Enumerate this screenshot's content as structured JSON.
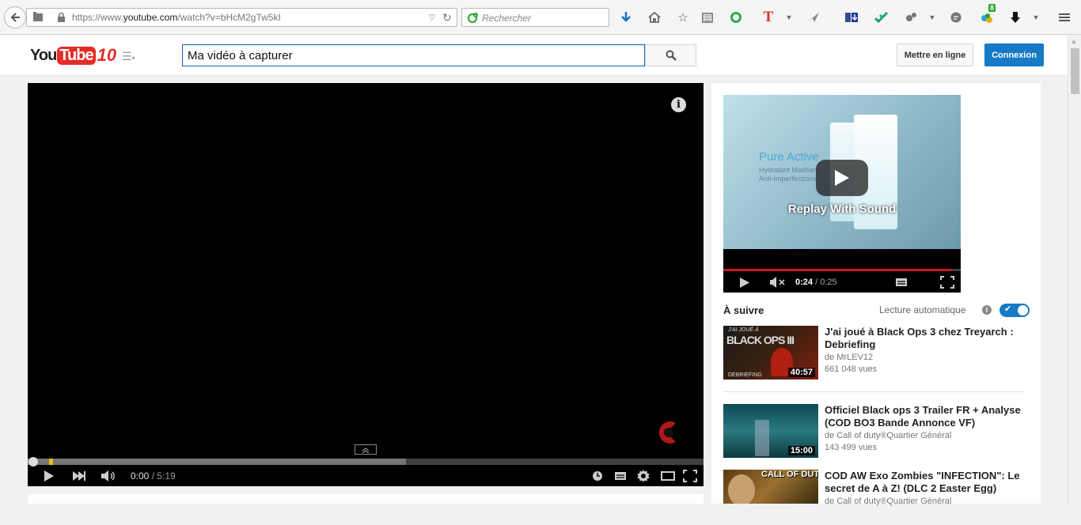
{
  "browser": {
    "url_prefix": "https://www.",
    "url_domain": "youtube.com",
    "url_path": "/watch?v=bHcM2gTw5kI",
    "search_placeholder": "Rechercher",
    "badge_count": "8"
  },
  "header": {
    "logo_you": "You",
    "logo_tube": "Tube",
    "logo_ten": "10",
    "search_value": "Ma vidéo à capturer",
    "upload_label": "Mettre en ligne",
    "login_label": "Connexion"
  },
  "player": {
    "current_time": "0:00",
    "separator": " / ",
    "duration": "5:19",
    "info_icon": "i",
    "progress_fraction": 0.0,
    "loaded_fraction": 0.56
  },
  "ad": {
    "brand": "Pure Active",
    "product_line_1": "Hydratant Matifiant",
    "product_line_2": "Anti-Imperfections",
    "replay_label": "Replay With Sound",
    "current_time": "0:24",
    "duration": "0:25",
    "progress_fraction": 0.96
  },
  "sidebar": {
    "up_next_label": "À suivre",
    "autoplay_label": "Lecture automatique",
    "autoplay_info": "i",
    "videos": [
      {
        "title": "J'ai joué à Black Ops 3 chez Treyarch : Debriefing",
        "channel": "de MrLEV12",
        "views": "661 048 vues",
        "duration": "40:57",
        "thumb_text": "BLACK OPS III"
      },
      {
        "title": "Officiel Black ops 3 Trailer FR + Analyse (COD BO3 Bande Annonce VF)",
        "channel": "de Call of duty®Quartier Général",
        "views": "143 499 vues",
        "duration": "15:00",
        "thumb_text": ""
      },
      {
        "title": "COD AW Exo Zombies \"INFECTION\": Le secret de A à Z! (DLC 2 Easter Egg)",
        "channel": "de Call of duty®Quartier Général",
        "views": "",
        "duration": "",
        "thumb_text": "CALL OF DUTY"
      }
    ]
  },
  "colors": {
    "yt_red": "#e52d27",
    "yt_blue": "#167ac6",
    "player_bg": "#000000"
  }
}
